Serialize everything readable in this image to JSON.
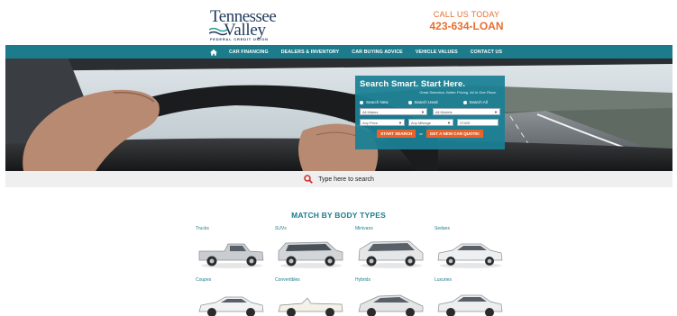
{
  "header": {
    "logo": {
      "line1": "Tennessee",
      "line2": "Valley",
      "subtitle": "FEDERAL CREDIT UNION"
    },
    "call_label": "CALL US TODAY",
    "call_number": "423-634-LOAN"
  },
  "nav": {
    "home_icon": "home-icon",
    "items": [
      "CAR FINANCING",
      "DEALERS & INVENTORY",
      "CAR BUYING ADVICE",
      "VEHICLE VALUES",
      "CONTACT US"
    ]
  },
  "search_box": {
    "title": "Search Smart. Start Here.",
    "subtitle": "Great Selection. Better Pricing. All In One Place.",
    "radios": [
      "Search New",
      "Search Used",
      "Search All"
    ],
    "makes": "All Makes",
    "models": "All Models",
    "price": "Any Price",
    "mileage": "Any Mileage",
    "zip": "37405",
    "start_button": "START SEARCH",
    "or_text": "or",
    "quote_button": "GET A NEW CAR QUOTE!"
  },
  "type_search": {
    "icon": "search-icon",
    "placeholder": "Type here to search"
  },
  "body_types": {
    "title": "MATCH BY BODY TYPES",
    "items": [
      "Trucks",
      "SUVs",
      "Minivans",
      "Sedans",
      "Coupes",
      "Convertibles",
      "Hybrids",
      "Luxuries"
    ]
  },
  "colors": {
    "teal": "#1c7c8c",
    "orange": "#e8632b",
    "navy": "#1f3a5a"
  }
}
